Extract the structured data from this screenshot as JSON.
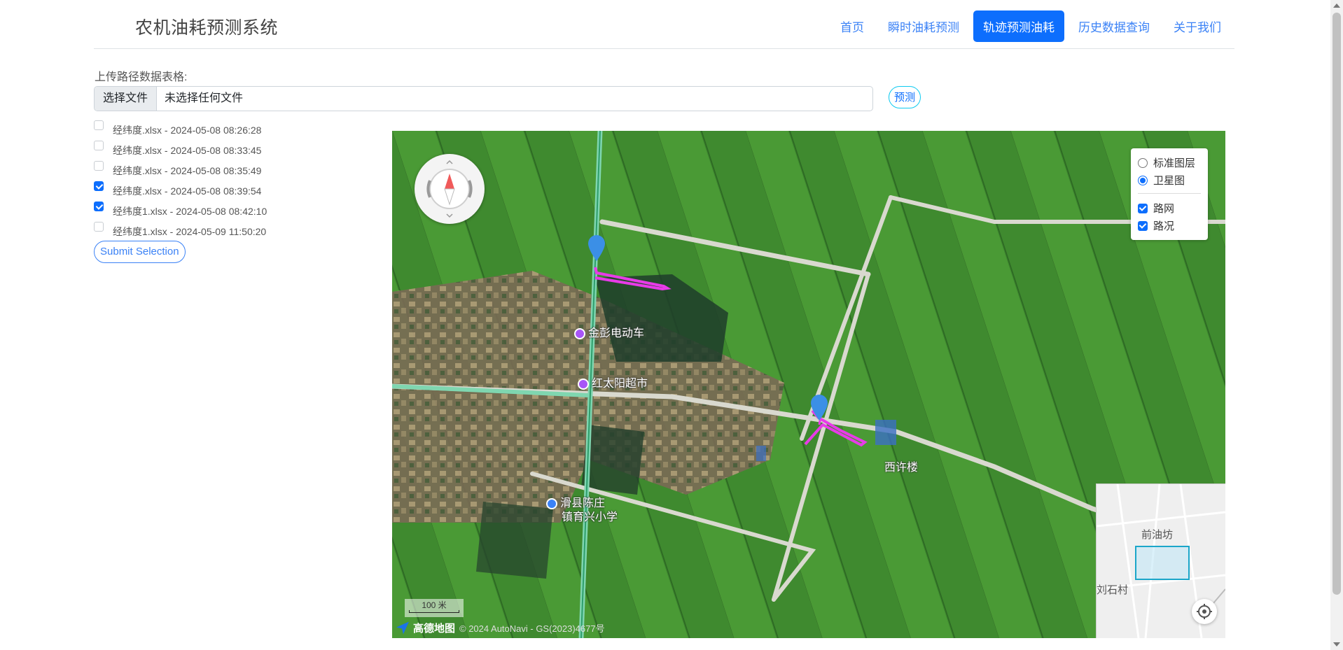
{
  "header": {
    "brand": "农机油耗预测系统",
    "nav": [
      {
        "label": "首页",
        "active": false
      },
      {
        "label": "瞬时油耗预测",
        "active": false
      },
      {
        "label": "轨迹预测油耗",
        "active": true
      },
      {
        "label": "历史数据查询",
        "active": false
      },
      {
        "label": "关于我们",
        "active": false
      }
    ]
  },
  "upload": {
    "label": "上传路径数据表格:",
    "choose_file": "选择文件",
    "file_status": "未选择任何文件",
    "predict": "预测"
  },
  "files": [
    {
      "label": "经纬度.xlsx - 2024-05-08 08:26:28",
      "checked": false
    },
    {
      "label": "经纬度.xlsx - 2024-05-08 08:33:45",
      "checked": false
    },
    {
      "label": "经纬度.xlsx - 2024-05-08 08:35:49",
      "checked": false
    },
    {
      "label": "经纬度.xlsx - 2024-05-08 08:39:54",
      "checked": true
    },
    {
      "label": "经纬度1.xlsx - 2024-05-08 08:42:10",
      "checked": true
    },
    {
      "label": "经纬度1.xlsx - 2024-05-09 11:50:20",
      "checked": false
    }
  ],
  "submit": "Submit Selection",
  "map": {
    "pois": [
      {
        "name": "金彭电动车",
        "icon": "shop-icon"
      },
      {
        "name": "红太阳超市",
        "icon": "shop-icon"
      },
      {
        "name": "西许楼",
        "icon": ""
      },
      {
        "name": "滑县陈庄",
        "icon": "school-icon"
      },
      {
        "name": "镇育兴小学",
        "icon": ""
      }
    ],
    "layers": {
      "standard": "标准图层",
      "satellite": "卫星图",
      "road": "路网",
      "traffic": "路况"
    },
    "overview_labels": [
      "前油坊",
      "刘石村"
    ],
    "scale": "100 米",
    "logo": "高德地图",
    "copyright": "© 2024 AutoNavi - GS(2023)4677号",
    "colors": {
      "track": "#e83be8",
      "marker": "#3b8fe6",
      "road": "#d9d9cf"
    }
  }
}
